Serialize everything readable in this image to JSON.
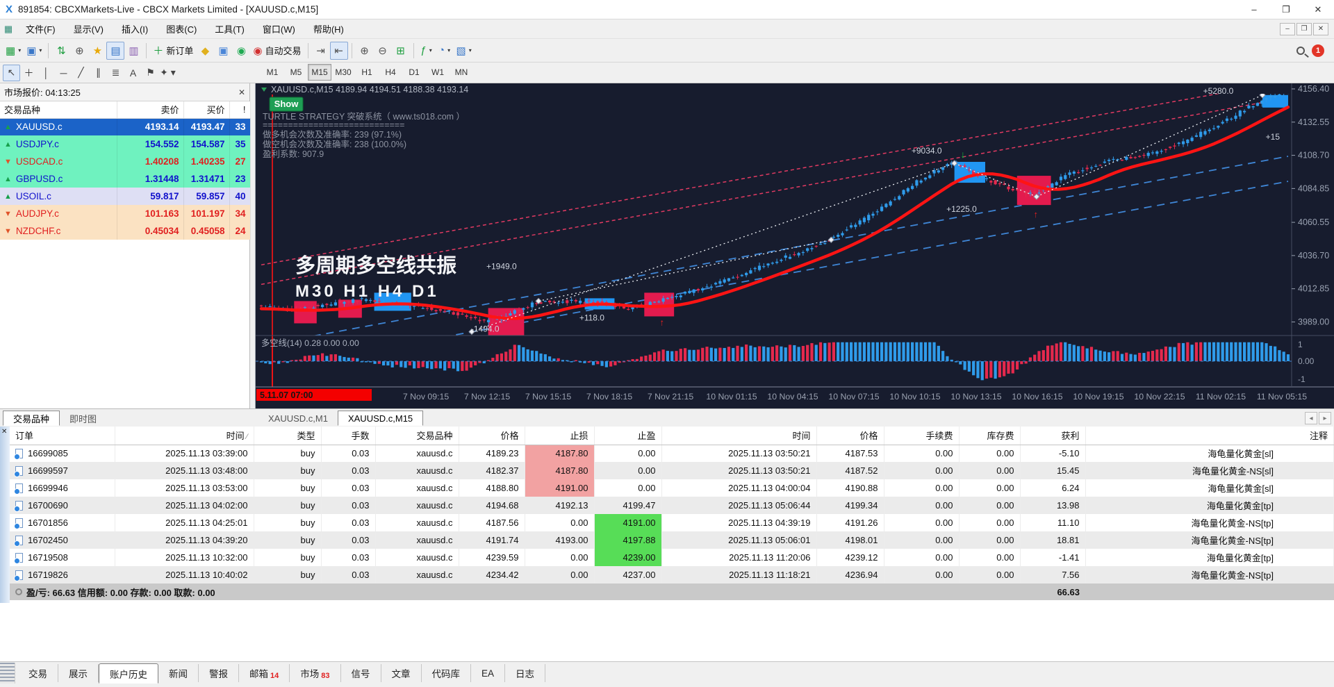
{
  "window": {
    "logo": "X",
    "title": "891854: CBCXMarkets-Live - CBCX Markets Limited - [XAUUSD.c,M15]",
    "controls": [
      "–",
      "❐",
      "✕"
    ],
    "menu": [
      "文件(F)",
      "显示(V)",
      "插入(I)",
      "图表(C)",
      "工具(T)",
      "窗口(W)",
      "帮助(H)"
    ],
    "mdi_controls": [
      "–",
      "❐",
      "✕"
    ]
  },
  "toolbar": {
    "buttons": [
      {
        "n": "new-chart-button",
        "g": "▦",
        "c": "#1d9e3f",
        "caret": true
      },
      {
        "n": "profiles-button",
        "g": "▣",
        "c": "#3a77c8",
        "caret": true
      },
      {
        "sep": true
      },
      {
        "n": "symbols-updown-button",
        "g": "⇅",
        "c": "#1d9e3f"
      },
      {
        "n": "crosshair-target-button",
        "g": "⊕",
        "c": "#555555"
      },
      {
        "n": "favorites-button",
        "g": "★",
        "c": "#e8a90a"
      },
      {
        "n": "market-watch-toggle",
        "g": "▤",
        "c": "#3a77c8",
        "active": true
      },
      {
        "n": "data-window-button",
        "g": "▥",
        "c": "#8a5fb0"
      },
      {
        "sep": true
      },
      {
        "n": "new-order-button",
        "g": "＋",
        "c": "#1d9e3f",
        "text": "新订单"
      },
      {
        "n": "history-center-button",
        "g": "◆",
        "c": "#e0b01e"
      },
      {
        "n": "terminal-button",
        "g": "▣",
        "c": "#4a86d8"
      },
      {
        "n": "signals-button",
        "g": "◉",
        "c": "#1faa52"
      },
      {
        "n": "autotrading-button",
        "g": "◉",
        "c": "#d22f2f",
        "text": "自动交易"
      },
      {
        "sep": true
      },
      {
        "n": "chart-shift-button",
        "g": "⇥",
        "c": "#555555"
      },
      {
        "n": "auto-scroll-button",
        "g": "⇤",
        "c": "#555555",
        "active": true
      },
      {
        "sep": true
      },
      {
        "n": "zoom-in-button",
        "g": "⊕",
        "c": "#555555"
      },
      {
        "n": "zoom-out-button",
        "g": "⊖",
        "c": "#555555"
      },
      {
        "n": "tile-windows-button",
        "g": "⊞",
        "c": "#1d9e3f"
      },
      {
        "sep": true
      },
      {
        "n": "indicators-button",
        "g": "ƒ",
        "c": "#1d9e3f",
        "caret": true
      },
      {
        "n": "periods-button",
        "g": "◔",
        "c": "#3a77c8",
        "caret": true
      },
      {
        "n": "templates-button",
        "g": "▧",
        "c": "#3a77c8",
        "caret": true
      }
    ],
    "notification_count": "1"
  },
  "drawing_tools": [
    {
      "n": "cursor-tool",
      "g": "↖",
      "active": true
    },
    {
      "n": "crosshair-tool",
      "g": "＋"
    },
    {
      "n": "vline-tool",
      "g": "│"
    },
    {
      "n": "hline-tool",
      "g": "─"
    },
    {
      "n": "trendline-tool",
      "g": "╱"
    },
    {
      "n": "channel-tool",
      "g": "∥"
    },
    {
      "n": "fibonacci-tool",
      "g": "≣"
    },
    {
      "n": "text-tool",
      "g": "A"
    },
    {
      "n": "label-tool",
      "g": "⚑"
    },
    {
      "n": "shapes-tool",
      "g": "✦",
      "caret": true
    }
  ],
  "timeframes": [
    {
      "label": "M1"
    },
    {
      "label": "M5"
    },
    {
      "label": "M15",
      "active": true
    },
    {
      "label": "M30"
    },
    {
      "label": "H1"
    },
    {
      "label": "H4"
    },
    {
      "label": "D1"
    },
    {
      "label": "W1"
    },
    {
      "label": "MN"
    }
  ],
  "market_watch": {
    "title": "市场报价: 04:13:25",
    "close_glyph": "✕",
    "columns": [
      "交易品种",
      "卖价",
      "买价",
      "!"
    ],
    "rows": [
      {
        "symbol": "XAUUSD.c",
        "bid": "4193.14",
        "ask": "4193.47",
        "spread": "33",
        "dir": "up",
        "style": "selected"
      },
      {
        "symbol": "USDJPY.c",
        "bid": "154.552",
        "ask": "154.587",
        "spread": "35",
        "dir": "up",
        "style": "mint-blue"
      },
      {
        "symbol": "USDCAD.c",
        "bid": "1.40208",
        "ask": "1.40235",
        "spread": "27",
        "dir": "down",
        "style": "mint-red"
      },
      {
        "symbol": "GBPUSD.c",
        "bid": "1.31448",
        "ask": "1.31471",
        "spread": "23",
        "dir": "up",
        "style": "mint-blue"
      },
      {
        "symbol": "USOIL.c",
        "bid": "59.817",
        "ask": "59.857",
        "spread": "40",
        "dir": "up",
        "style": "lav-blue"
      },
      {
        "symbol": "AUDJPY.c",
        "bid": "101.163",
        "ask": "101.197",
        "spread": "34",
        "dir": "down",
        "style": "peach-red"
      },
      {
        "symbol": "NZDCHF.c",
        "bid": "0.45034",
        "ask": "0.45058",
        "spread": "24",
        "dir": "down",
        "style": "peach-red"
      }
    ],
    "tabs": [
      {
        "label": "交易品种",
        "active": true
      },
      {
        "label": "即时图"
      }
    ]
  },
  "chart": {
    "header_symbol": "XAUUSD.c,M15",
    "header_ohlc": "4189.94 4194.51 4188.38 4193.14",
    "show_button": "Show",
    "overlay_lines": [
      "TURTLE STRATEGY 突破系统（ www.ts018.com ）",
      "============================",
      "做多机会次数及准确率: 239 (97.1%)",
      "做空机会次数及准确率: 238 (100.0%)",
      "盈利系数: 907.9"
    ],
    "watermark_line1": "多周期多空线共振",
    "watermark_line2": "M30  H1  H4  D1",
    "indicator_label": "多空线(14) 0.28 0.00 0.00",
    "indicator_axis": [
      "1",
      "0.00",
      "-1"
    ],
    "time_tag": "5.11.07 07:00",
    "time_labels": [
      "7 Nov 09:15",
      "7 Nov 12:15",
      "7 Nov 15:15",
      "7 Nov 18:15",
      "7 Nov 21:15",
      "10 Nov 01:15",
      "10 Nov 04:15",
      "10 Nov 07:15",
      "10 Nov 10:15",
      "10 Nov 13:15",
      "10 Nov 16:15",
      "10 Nov 19:15",
      "10 Nov 22:15",
      "11 Nov 02:15",
      "11 Nov 05:15"
    ],
    "tabs": [
      {
        "label": "XAUUSD.c,M1"
      },
      {
        "label": "XAUUSD.c,M15",
        "active": true
      }
    ],
    "nav_arrows": [
      "◂",
      "▸"
    ],
    "chart_data": {
      "type": "candlestick",
      "symbol": "XAUUSD.c",
      "timeframe": "M15",
      "ohlc_current": {
        "open": 4189.94,
        "high": 4194.51,
        "low": 4188.38,
        "close": 4193.14
      },
      "price_ticks": [
        "4156.40",
        "4132.55",
        "4108.70",
        "4084.85",
        "4060.55",
        "4036.70",
        "4012.85",
        "3989.00"
      ],
      "price_keypoints": [
        [
          0,
          4000
        ],
        [
          0.03,
          3997
        ],
        [
          0.06,
          4001
        ],
        [
          0.1,
          4005
        ],
        [
          0.14,
          4002
        ],
        [
          0.18,
          3997
        ],
        [
          0.225,
          3989
        ],
        [
          0.27,
          4003
        ],
        [
          0.32,
          4004
        ],
        [
          0.36,
          3999
        ],
        [
          0.4,
          4006
        ],
        [
          0.45,
          4018
        ],
        [
          0.5,
          4032
        ],
        [
          0.55,
          4046
        ],
        [
          0.6,
          4068
        ],
        [
          0.645,
          4092
        ],
        [
          0.675,
          4104
        ],
        [
          0.7,
          4094
        ],
        [
          0.73,
          4085
        ],
        [
          0.755,
          4081
        ],
        [
          0.79,
          4096
        ],
        [
          0.83,
          4105
        ],
        [
          0.87,
          4110
        ],
        [
          0.905,
          4120
        ],
        [
          0.94,
          4133
        ],
        [
          0.97,
          4146
        ],
        [
          1,
          4155
        ]
      ],
      "trade_boxes": [
        {
          "x1": 0.032,
          "x2": 0.054,
          "p1": 4004,
          "p2": 3988,
          "kind": "sell"
        },
        {
          "x1": 0.075,
          "x2": 0.098,
          "p1": 4005,
          "p2": 3992,
          "kind": "sell"
        },
        {
          "x1": 0.11,
          "x2": 0.146,
          "p1": 4010,
          "p2": 3997,
          "kind": "buy"
        },
        {
          "x1": 0.221,
          "x2": 0.256,
          "p1": 3999,
          "p2": 3979,
          "kind": "sell"
        },
        {
          "x1": 0.315,
          "x2": 0.344,
          "p1": 4006,
          "p2": 3998,
          "kind": "buy"
        },
        {
          "x1": 0.373,
          "x2": 0.402,
          "p1": 4010,
          "p2": 3993,
          "kind": "sell"
        },
        {
          "x1": 0.675,
          "x2": 0.705,
          "p1": 4104,
          "p2": 4089,
          "kind": "buy"
        },
        {
          "x1": 0.736,
          "x2": 0.769,
          "p1": 4094,
          "p2": 4073,
          "kind": "sell"
        },
        {
          "x1": 0.975,
          "x2": 1,
          "p1": 4152,
          "p2": 4143,
          "kind": "buy"
        }
      ],
      "upper_bands": [
        [
          4030,
          4162
        ],
        [
          4016,
          4150
        ]
      ],
      "lower_bands": [
        [
          3972,
          4108
        ],
        [
          3954,
          4090
        ]
      ],
      "zigzag": [
        [
          [
            0.205,
            3982
          ],
          [
            0.675,
            4103
          ]
        ],
        [
          [
            0.675,
            4103
          ],
          [
            0.755,
            4079
          ]
        ],
        [
          [
            0.755,
            4079
          ],
          [
            0.975,
            4152
          ]
        ],
        [
          [
            0.27,
            4004
          ],
          [
            0.555,
            4048
          ]
        ]
      ],
      "annotations": [
        {
          "text": "+1949.0",
          "x": 0.234,
          "p": 4027
        },
        {
          "text": "-1494.0",
          "x": 0.218,
          "p": 3982
        },
        {
          "text": "+118.0",
          "x": 0.322,
          "p": 3990
        },
        {
          "text": "+9034.0",
          "x": 0.648,
          "p": 4110
        },
        {
          "text": "+1225.0",
          "x": 0.682,
          "p": 4068
        },
        {
          "text": "+5280.0",
          "x": 0.932,
          "p": 4153
        },
        {
          "text": "+15",
          "x": 0.985,
          "p": 4120
        }
      ],
      "indicator_name": "多空线(14)"
    }
  },
  "orders": {
    "columns": [
      "订单",
      "时间",
      "类型",
      "手数",
      "交易品种",
      "价格",
      "止损",
      "止盈",
      "时间",
      "价格",
      "手续费",
      "库存费",
      "获利",
      "注释"
    ],
    "sort_glyph": "∕",
    "rows": [
      {
        "order": "16699085",
        "open_time": "2025.11.13 03:39:00",
        "type": "buy",
        "lots": "0.03",
        "symbol": "xauusd.c",
        "price": "4189.23",
        "sl": "4187.80",
        "sl_hl": true,
        "tp": "0.00",
        "tp_hl": false,
        "close_time": "2025.11.13 03:50:21",
        "close_price": "4187.53",
        "commission": "0.00",
        "swap": "0.00",
        "profit": "-5.10",
        "comment": "海龟量化黄金[sl]"
      },
      {
        "order": "16699597",
        "open_time": "2025.11.13 03:48:00",
        "type": "buy",
        "lots": "0.03",
        "symbol": "xauusd.c",
        "price": "4182.37",
        "sl": "4187.80",
        "sl_hl": true,
        "tp": "0.00",
        "tp_hl": false,
        "close_time": "2025.11.13 03:50:21",
        "close_price": "4187.52",
        "commission": "0.00",
        "swap": "0.00",
        "profit": "15.45",
        "comment": "海龟量化黄金-NS[sl]"
      },
      {
        "order": "16699946",
        "open_time": "2025.11.13 03:53:00",
        "type": "buy",
        "lots": "0.03",
        "symbol": "xauusd.c",
        "price": "4188.80",
        "sl": "4191.00",
        "sl_hl": true,
        "tp": "0.00",
        "tp_hl": false,
        "close_time": "2025.11.13 04:00:04",
        "close_price": "4190.88",
        "commission": "0.00",
        "swap": "0.00",
        "profit": "6.24",
        "comment": "海龟量化黄金[sl]"
      },
      {
        "order": "16700690",
        "open_time": "2025.11.13 04:02:00",
        "type": "buy",
        "lots": "0.03",
        "symbol": "xauusd.c",
        "price": "4194.68",
        "sl": "4192.13",
        "sl_hl": false,
        "tp": "4199.47",
        "tp_hl": false,
        "close_time": "2025.11.13 05:06:44",
        "close_price": "4199.34",
        "commission": "0.00",
        "swap": "0.00",
        "profit": "13.98",
        "comment": "海龟量化黄金[tp]"
      },
      {
        "order": "16701856",
        "open_time": "2025.11.13 04:25:01",
        "type": "buy",
        "lots": "0.03",
        "symbol": "xauusd.c",
        "price": "4187.56",
        "sl": "0.00",
        "sl_hl": false,
        "tp": "4191.00",
        "tp_hl": true,
        "close_time": "2025.11.13 04:39:19",
        "close_price": "4191.26",
        "commission": "0.00",
        "swap": "0.00",
        "profit": "11.10",
        "comment": "海龟量化黄金-NS[tp]"
      },
      {
        "order": "16702450",
        "open_time": "2025.11.13 04:39:20",
        "type": "buy",
        "lots": "0.03",
        "symbol": "xauusd.c",
        "price": "4191.74",
        "sl": "4193.00",
        "sl_hl": false,
        "tp": "4197.88",
        "tp_hl": true,
        "close_time": "2025.11.13 05:06:01",
        "close_price": "4198.01",
        "commission": "0.00",
        "swap": "0.00",
        "profit": "18.81",
        "comment": "海龟量化黄金-NS[tp]"
      },
      {
        "order": "16719508",
        "open_time": "2025.11.13 10:32:00",
        "type": "buy",
        "lots": "0.03",
        "symbol": "xauusd.c",
        "price": "4239.59",
        "sl": "0.00",
        "sl_hl": false,
        "tp": "4239.00",
        "tp_hl": true,
        "close_time": "2025.11.13 11:20:06",
        "close_price": "4239.12",
        "commission": "0.00",
        "swap": "0.00",
        "profit": "-1.41",
        "comment": "海龟量化黄金[tp]"
      },
      {
        "order": "16719826",
        "open_time": "2025.11.13 10:40:02",
        "type": "buy",
        "lots": "0.03",
        "symbol": "xauusd.c",
        "price": "4234.42",
        "sl": "0.00",
        "sl_hl": false,
        "tp": "4237.00",
        "tp_hl": false,
        "close_time": "2025.11.13 11:18:21",
        "close_price": "4236.94",
        "commission": "0.00",
        "swap": "0.00",
        "profit": "7.56",
        "comment": "海龟量化黄金-NS[tp]"
      }
    ],
    "footer_summary": "盈/亏: 66.63  信用额: 0.00  存款: 0.00  取款: 0.00",
    "footer_profit": "66.63"
  },
  "bottom_tabs": [
    {
      "label": "交易"
    },
    {
      "label": "展示"
    },
    {
      "label": "账户历史",
      "active": true
    },
    {
      "label": "新闻"
    },
    {
      "label": "警报"
    },
    {
      "label": "邮箱",
      "badge": "14"
    },
    {
      "label": "市场",
      "badge": "83"
    },
    {
      "label": "信号"
    },
    {
      "label": "文章"
    },
    {
      "label": "代码库"
    },
    {
      "label": "EA"
    },
    {
      "label": "日志"
    }
  ],
  "colors": {
    "chart_bg": "#171c2e",
    "bull": "#2f9bea",
    "bear": "#e5294d",
    "ma_line": "#ff1414",
    "upper_band": "#e23a62",
    "lower_band": "#3f86d6",
    "zigzag": "#eceff4",
    "axis_text": "#99a1b1",
    "selected_row": "#1b63c8",
    "mint_row": "#6ff2bf",
    "lavender_row": "#dedff4",
    "peach_row": "#fbe2c2",
    "price_up_text": "#1111cc",
    "price_down_text": "#e01f1f",
    "sl_highlight": "#f2a2a2",
    "tp_highlight": "#57dd57",
    "time_tag_bg": "#f40000",
    "show_button_bg": "#1f9e54"
  }
}
